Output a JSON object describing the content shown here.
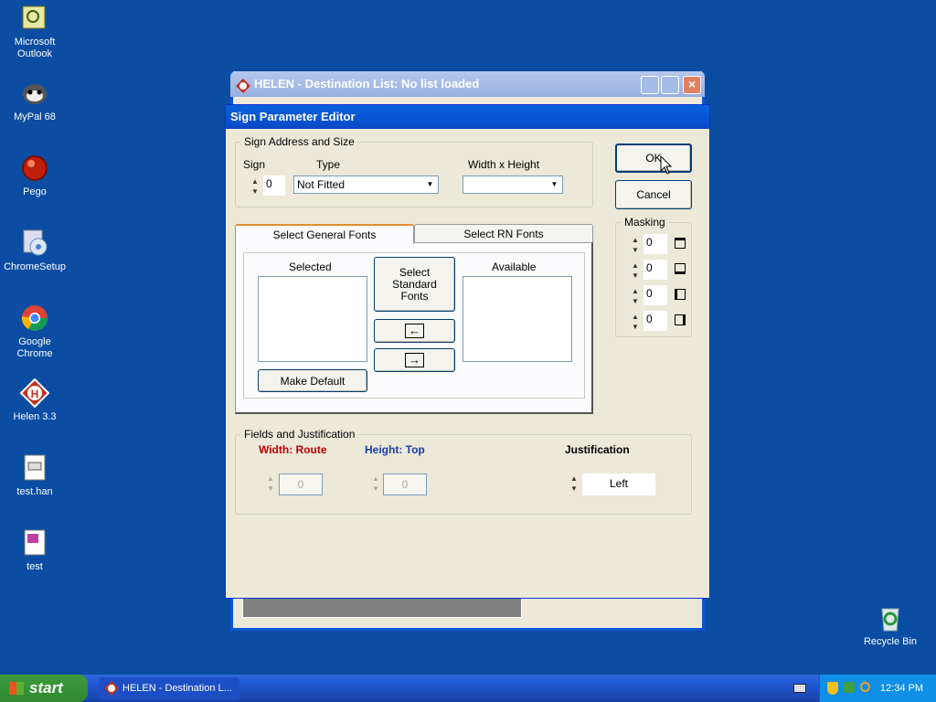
{
  "desktop": {
    "icons": [
      {
        "label": "Microsoft Outlook",
        "icon": "outlook-icon"
      },
      {
        "label": "MyPal 68",
        "icon": "mypal-icon"
      },
      {
        "label": "Pego",
        "icon": "pego-icon"
      },
      {
        "label": "ChromeSetup",
        "icon": "chrome-setup-icon"
      },
      {
        "label": "Google Chrome",
        "icon": "chrome-icon"
      },
      {
        "label": "Helen 3.3",
        "icon": "helen-icon"
      },
      {
        "label": "test.han",
        "icon": "file-icon"
      },
      {
        "label": "test",
        "icon": "file-icon"
      }
    ],
    "recycle_bin": "Recycle Bin"
  },
  "bg_window": {
    "title": "HELEN - Destination List: No list loaded"
  },
  "dialog": {
    "title": "Sign Parameter Editor",
    "sign_group": {
      "label": "Sign Address and Size",
      "sign_label": "Sign",
      "sign_value": "0",
      "type_label": "Type",
      "type_value": "Not Fitted",
      "wh_label": "Width x Height",
      "wh_value": ""
    },
    "ok_label": "OK",
    "cancel_label": "Cancel",
    "masking": {
      "label": "Masking",
      "values": [
        "0",
        "0",
        "0",
        "0"
      ]
    },
    "tabs": [
      "Select General Fonts",
      "Select RN Fonts"
    ],
    "fonts": {
      "selected_label": "Selected",
      "available_label": "Available",
      "standard_label": "Select Standard Fonts",
      "make_default_label": "Make Default"
    },
    "fields": {
      "label": "Fields and Justification",
      "width_label": "Width: Route",
      "height_label": "Height: Top",
      "justification_label": "Justification",
      "width_value": "0",
      "height_value": "0",
      "justification_value": "Left",
      "width_color": "#c00000",
      "height_color": "#1a3ca8"
    }
  },
  "taskbar": {
    "start_label": "start",
    "item_label": "HELEN - Destination L...",
    "clock": "12:34 PM"
  }
}
